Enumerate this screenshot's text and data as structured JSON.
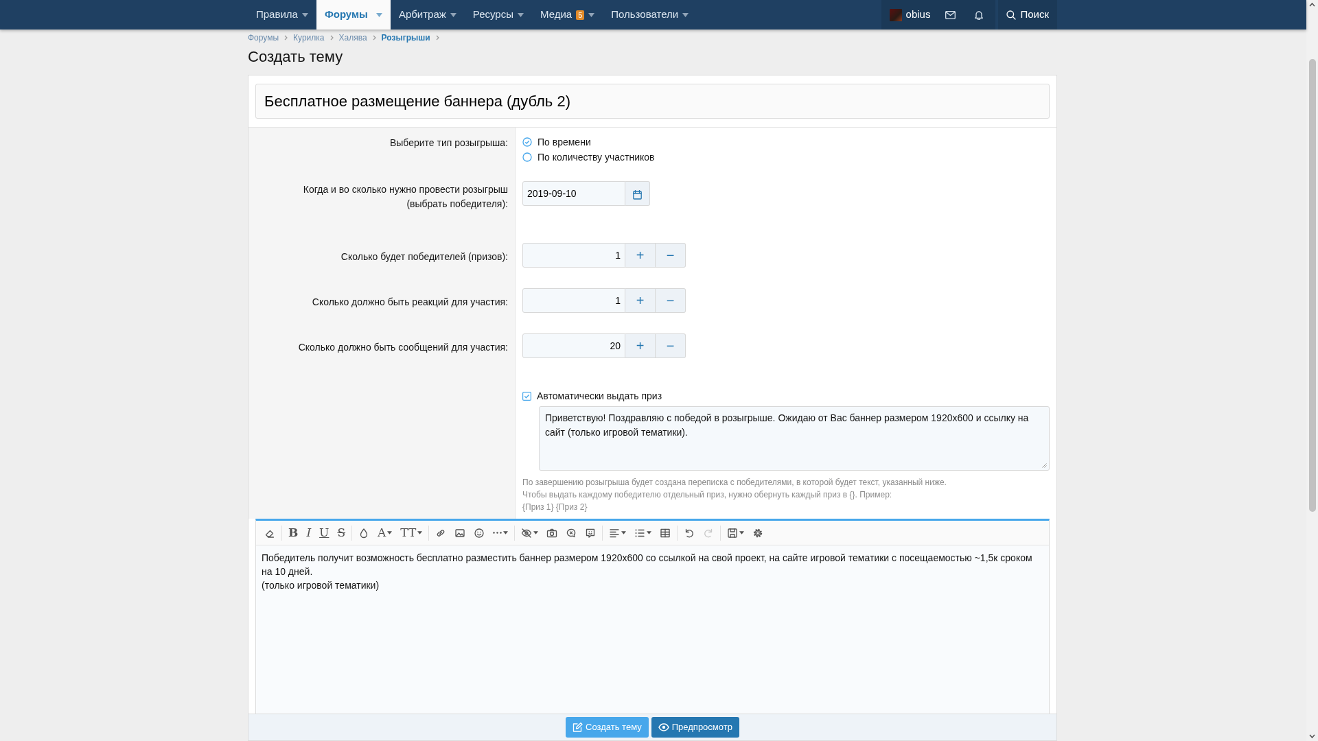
{
  "nav": {
    "items": [
      {
        "label": "Правила",
        "selected": false,
        "dropdown": true
      },
      {
        "label": "Форумы",
        "selected": true,
        "dropdown": true
      },
      {
        "label": "Арбитраж",
        "selected": false,
        "dropdown": true
      },
      {
        "label": "Ресурсы",
        "selected": false,
        "dropdown": true
      },
      {
        "label": "Медиа",
        "selected": false,
        "dropdown": true,
        "badge": "5"
      },
      {
        "label": "Пользователи",
        "selected": false,
        "dropdown": true
      }
    ],
    "user": {
      "name": "obius"
    },
    "search": {
      "label": "Поиск"
    }
  },
  "breadcrumbs": [
    {
      "label": "Форумы",
      "current": false
    },
    {
      "label": "Курилка",
      "current": false
    },
    {
      "label": "Халява",
      "current": false
    },
    {
      "label": "Розыгрыши",
      "current": true
    }
  ],
  "page_title": "Создать тему",
  "title_field": {
    "value": "Бесплатное размещение баннера (дубль 2)"
  },
  "form": {
    "type": {
      "label": "Выберите тип розыгрыша:",
      "options": [
        {
          "label": "По времени",
          "selected": true
        },
        {
          "label": "По количеству участников",
          "selected": false
        }
      ]
    },
    "date": {
      "label": "Когда и во сколько нужно провести розыгрыш (выбрать победителя):",
      "value": "2019-09-10"
    },
    "counters": [
      {
        "label": "Сколько будет победителей (призов):",
        "value": "1",
        "plus": "+",
        "minus": "−"
      },
      {
        "label": "Сколько должно быть реакций для участия:",
        "value": "1",
        "plus": "+",
        "minus": "−"
      },
      {
        "label": "Сколько должно быть сообщений для участия:",
        "value": "20",
        "plus": "+",
        "minus": "−"
      }
    ],
    "auto_prize": {
      "label": "Автоматически выдать приз",
      "checked": true,
      "message": "Приветствую! Поздравляю с победой в розыгрыше. Ожидаю от Вас баннер размером 1920x600 и ссылку на сайт (только игровой тематики).",
      "hint": [
        "По завершению розыгрыша будет создана переписка с победителями, в которой будет текст, указанный ниже.",
        "Чтобы выдать каждому победителю отдельный приз, нужно обернуть каждый приз в {}. Пример:",
        "{Приз 1} {Приз 2}"
      ]
    }
  },
  "editor": {
    "toolbar_groups": [
      [
        {
          "kind": "icon",
          "dropdown": false,
          "disabled": false
        }
      ],
      [
        {
          "kind": "glyph",
          "label": "B",
          "dropdown": false,
          "disabled": false
        },
        {
          "kind": "glyph",
          "label": "I",
          "dropdown": false,
          "disabled": false
        },
        {
          "kind": "glyph",
          "label": "U",
          "dropdown": false,
          "disabled": false
        },
        {
          "kind": "glyph",
          "label": "S",
          "dropdown": false,
          "disabled": false
        }
      ],
      [
        {
          "kind": "icon",
          "dropdown": false,
          "disabled": false
        },
        {
          "kind": "glyph",
          "label": "A",
          "dropdown": true,
          "disabled": false
        },
        {
          "kind": "glyph",
          "label": "TT",
          "dropdown": true,
          "disabled": false
        }
      ],
      [
        {
          "kind": "icon",
          "dropdown": false,
          "disabled": false
        },
        {
          "kind": "icon",
          "dropdown": false,
          "disabled": false
        },
        {
          "kind": "icon",
          "dropdown": false,
          "disabled": false
        },
        {
          "kind": "icon",
          "dropdown": true,
          "disabled": false
        }
      ],
      [
        {
          "kind": "icon",
          "dropdown": true,
          "disabled": false
        },
        {
          "kind": "icon",
          "dropdown": false,
          "disabled": false
        },
        {
          "kind": "icon",
          "dropdown": false,
          "disabled": false
        },
        {
          "kind": "icon",
          "dropdown": false,
          "disabled": false
        }
      ],
      [
        {
          "kind": "icon",
          "dropdown": true,
          "disabled": false
        },
        {
          "kind": "icon",
          "dropdown": true,
          "disabled": false
        },
        {
          "kind": "icon",
          "dropdown": false,
          "disabled": false
        }
      ],
      [
        {
          "kind": "icon",
          "dropdown": false,
          "disabled": false
        },
        {
          "kind": "icon",
          "dropdown": false,
          "disabled": true
        }
      ],
      [
        {
          "kind": "icon",
          "dropdown": true,
          "disabled": false
        },
        {
          "kind": "icon",
          "dropdown": false,
          "disabled": false
        }
      ]
    ],
    "paragraphs": [
      "Победитель получит возможность бесплатно разместить баннер размером 1920x600 со ссылкой на свой проект, на сайте игровой тематики с посещаемостью ~1,5к сроком на 10 дней.",
      "(только игровой тематики)"
    ]
  },
  "buttons": [
    {
      "label": "Создать тему",
      "kind": "submit"
    },
    {
      "label": "Предпросмотр",
      "kind": "preview"
    }
  ]
}
